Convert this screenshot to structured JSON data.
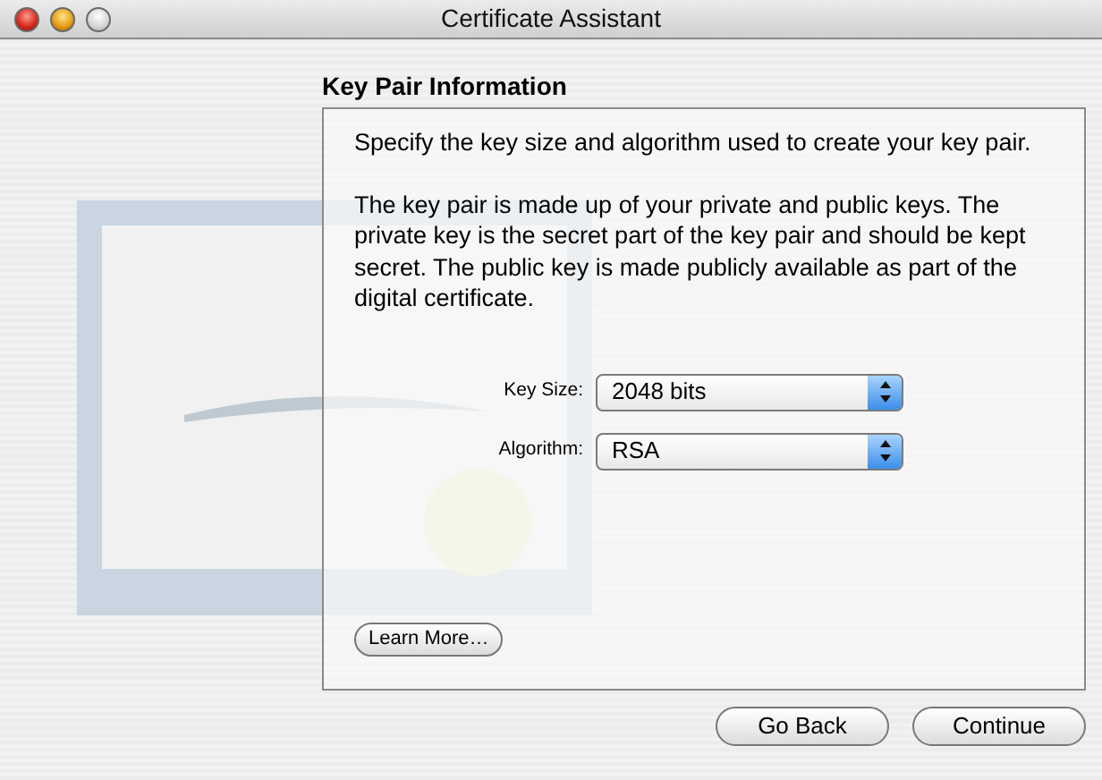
{
  "window": {
    "title": "Certificate Assistant"
  },
  "traffic_lights": [
    {
      "kind": "close",
      "disabled": false
    },
    {
      "kind": "minimize",
      "disabled": false
    },
    {
      "kind": "zoom",
      "disabled": true
    }
  ],
  "heading": "Key Pair Information",
  "paragraphs": [
    "Specify the key size and algorithm used to create your key pair.",
    "The key pair is made up of your private and public keys. The private key is the secret part of the key pair and should be kept secret. The public key is made publicly available as part of the digital certificate."
  ],
  "fields": [
    {
      "label": "Key Size:",
      "value": "2048 bits"
    },
    {
      "label": "Algorithm:",
      "value": "RSA"
    }
  ],
  "learn_more": "Learn More…",
  "buttons": [
    {
      "label": "Go Back"
    },
    {
      "label": "Continue"
    }
  ]
}
